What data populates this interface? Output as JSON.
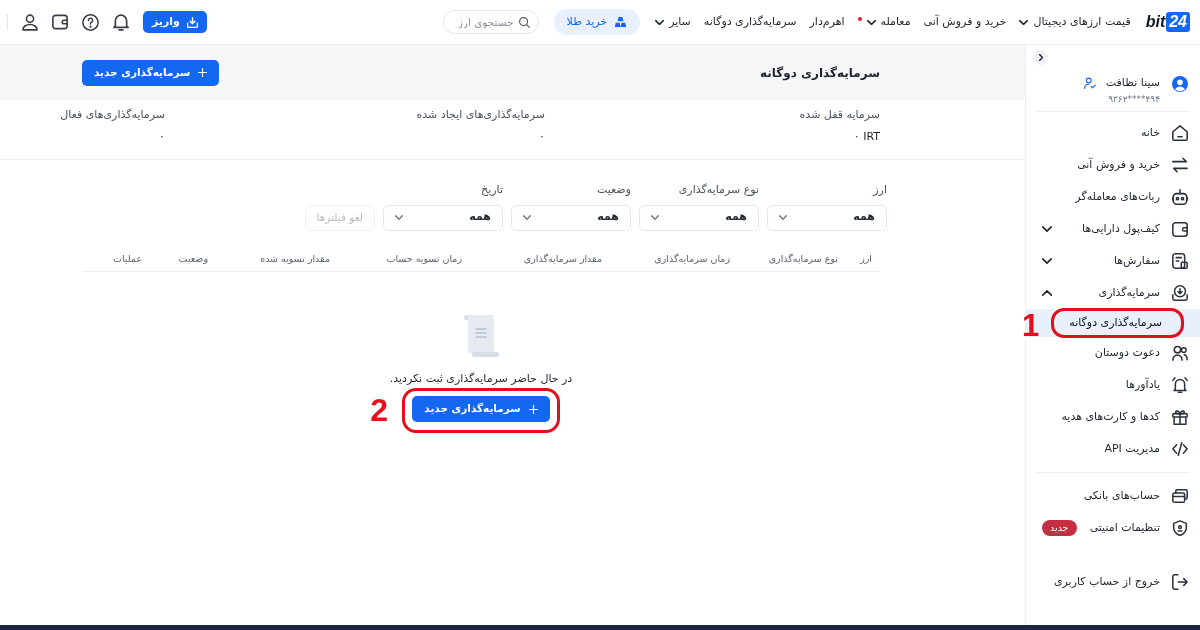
{
  "top_bar": {
    "logo": {
      "text": "bit",
      "badge": "24"
    },
    "nav": [
      {
        "label": "قیمت ارزهای دیجیتال",
        "menu": true,
        "dot": false
      },
      {
        "label": "خرید و فروش آنی",
        "menu": false,
        "dot": false
      },
      {
        "label": "معامله",
        "menu": true,
        "dot": true
      },
      {
        "label": "اهرم‌دار",
        "menu": false,
        "dot": false
      },
      {
        "label": "سرمایه‌گذاری دوگانه",
        "menu": false,
        "dot": false
      },
      {
        "label": "سایر",
        "menu": true,
        "dot": false
      }
    ],
    "gold_button": "خرید طلا",
    "search": {
      "placeholder": "جستجوی ارز"
    },
    "deposit_button": "واریز"
  },
  "page_header": {
    "title": "سرمایه‌گذاری دوگانه",
    "new_button": "سرمایه‌گذاری جدید"
  },
  "stats": [
    {
      "label": "سرمایه قفل شده",
      "value": "۰ IRT"
    },
    {
      "label": "سرمایه‌گذاری‌های ایجاد شده",
      "value": "۰"
    },
    {
      "label": "سرمایه‌گذاری‌های فعال",
      "value": "۰"
    }
  ],
  "filters": {
    "fields": [
      {
        "label": "ارز",
        "value": "همه"
      },
      {
        "label": "نوع سرمایه‌گذاری",
        "value": "همه"
      },
      {
        "label": "وضعیت",
        "value": "همه"
      },
      {
        "label": "تاریخ",
        "value": "همه"
      }
    ],
    "clear_button": {
      "label": "لغو فیلترها",
      "disabled": true
    }
  },
  "table": {
    "columns": [
      "ارز",
      "نوع سرمایه‌گذاری",
      "زمان سرمایه‌گذاری",
      "مقدار سرمایه‌گذاری",
      "زمان تسویه حساب",
      "مقدار تسویه شده",
      "وضعیت",
      "عملیات"
    ]
  },
  "empty_state": {
    "message": "در حال حاضر سرمایه‌گذاری ثبت نکردید.",
    "button": "سرمایه‌گذاری جدید",
    "annotation": "2"
  },
  "sidebar": {
    "profile": {
      "name": "سینا نظافت",
      "phone": "۹۳۶۲****۴۹۴"
    },
    "sections": [
      {
        "items": [
          {
            "label": "خانه",
            "selected": false
          },
          {
            "label": "خرید و فروش آنی",
            "selected": false
          },
          {
            "label": "ربات‌های معامله‌گر",
            "selected": false
          },
          {
            "label": "کیف‌پول دارایی‌ها",
            "selected": false,
            "expanded": false
          },
          {
            "label": "سفارش‌ها",
            "selected": false,
            "expanded": false
          },
          {
            "label": "سرمایه‌گذاری",
            "selected": false,
            "expanded": true,
            "children": [
              {
                "label": "سرمایه‌گذاری دوگانه",
                "selected": true,
                "annotation": "1"
              }
            ]
          },
          {
            "label": "دعوت دوستان",
            "selected": false
          },
          {
            "label": "یادآورها",
            "selected": false
          },
          {
            "label": "کدها و کارت‌های هدیه",
            "selected": false
          },
          {
            "label": "مدیریت API",
            "selected": false
          }
        ]
      },
      {
        "items": [
          {
            "label": "حساب‌های بانکی",
            "selected": false
          },
          {
            "label": "تنظیمات امنیتی",
            "selected": false,
            "badge": "جدید"
          }
        ]
      }
    ],
    "logout": {
      "label": "خروج از حساب کاربری"
    }
  }
}
